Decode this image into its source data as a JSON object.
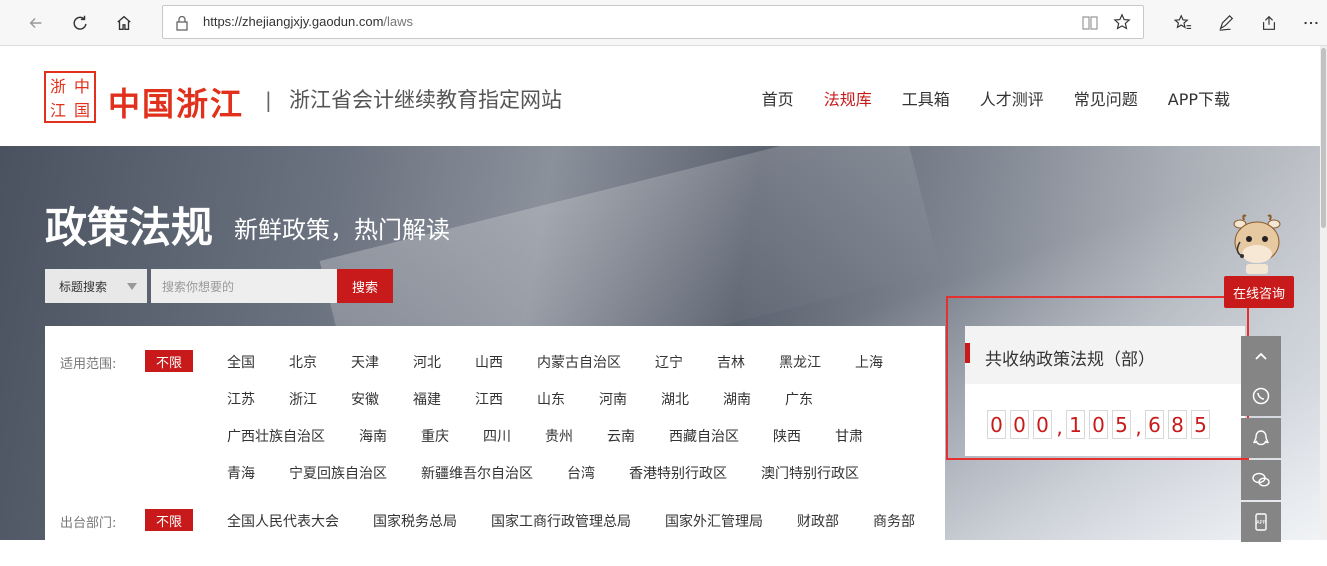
{
  "browser": {
    "url_host": "https://zhejiangjxjy.gaodun.com",
    "url_path": "/laws"
  },
  "site": {
    "logo_chars": [
      "浙",
      "中",
      "江",
      "国"
    ],
    "logo_text": "中国浙江",
    "divider": "|",
    "subtitle": "浙江省会计继续教育指定网站",
    "nav": [
      "首页",
      "法规库",
      "工具箱",
      "人才测评",
      "常见问题",
      "APP下载"
    ]
  },
  "hero": {
    "title": "政策法规",
    "subtitle": "新鲜政策，热门解读"
  },
  "search": {
    "select_value": "标题搜索",
    "placeholder": "搜索你想要的",
    "button": "搜索"
  },
  "filters": {
    "scope_label": "适用范围:",
    "scope_tag": "不限",
    "scope_options": [
      [
        "全国",
        "北京",
        "天津",
        "河北",
        "山西",
        "内蒙古自治区",
        "辽宁",
        "吉林",
        "黑龙江",
        "上海"
      ],
      [
        "江苏",
        "浙江",
        "安徽",
        "福建",
        "江西",
        "山东",
        "河南",
        "湖北",
        "湖南",
        "广东"
      ],
      [
        "广西壮族自治区",
        "海南",
        "重庆",
        "四川",
        "贵州",
        "云南",
        "西藏自治区",
        "陕西",
        "甘肃"
      ],
      [
        "青海",
        "宁夏回族自治区",
        "新疆维吾尔自治区",
        "台湾",
        "香港特别行政区",
        "澳门特别行政区"
      ]
    ],
    "dept_label": "出台部门:",
    "dept_tag": "不限",
    "dept_options": [
      "全国人民代表大会",
      "国家税务总局",
      "国家工商行政管理总局",
      "国家外汇管理局",
      "财政部",
      "商务部"
    ]
  },
  "stats": {
    "title": "共收纳政策法规（部）",
    "groups": [
      "000",
      "105",
      "685"
    ],
    "separator": ","
  },
  "consult": {
    "button": "在线咨询"
  },
  "side_tools": [
    "back-to-top-icon",
    "whatsapp-phone-icon",
    "qq-icon",
    "wechat-icon",
    "app-download-icon"
  ],
  "colors": {
    "brand": "#e1301b",
    "accent": "#c81a1a"
  }
}
